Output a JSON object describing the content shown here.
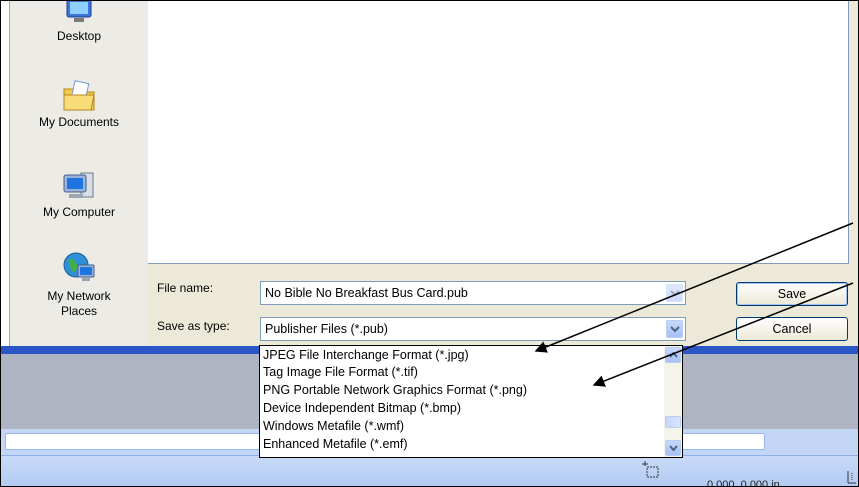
{
  "places_bar": {
    "items": [
      {
        "label": "Desktop",
        "icon": "desktop-icon"
      },
      {
        "label": "My Documents",
        "icon": "my-documents-icon"
      },
      {
        "label": "My Computer",
        "icon": "my-computer-icon"
      },
      {
        "label": "My Network\nPlaces",
        "icon": "my-network-places-icon"
      }
    ]
  },
  "form": {
    "file_name_label": "File name:",
    "file_name_value": "No Bible No Breakfast Bus Card.pub",
    "save_as_type_label": "Save as type:",
    "save_as_type_value": "Publisher Files (*.pub)"
  },
  "buttons": {
    "save": "Save",
    "cancel": "Cancel"
  },
  "type_options": [
    "JPEG File Interchange Format (*.jpg)",
    "Tag Image File Format (*.tif)",
    "PNG Portable Network Graphics Format (*.png)",
    "Device Independent Bitmap (*.bmp)",
    "Windows Metafile (*.wmf)",
    "Enhanced Metafile (*.emf)"
  ],
  "status_bar": {
    "coordinates": "0.000, 0.000 in."
  },
  "colors": {
    "xp_blue": "#2a56c7",
    "dialog_face": "#ece9d8",
    "arrow": "#000000"
  }
}
